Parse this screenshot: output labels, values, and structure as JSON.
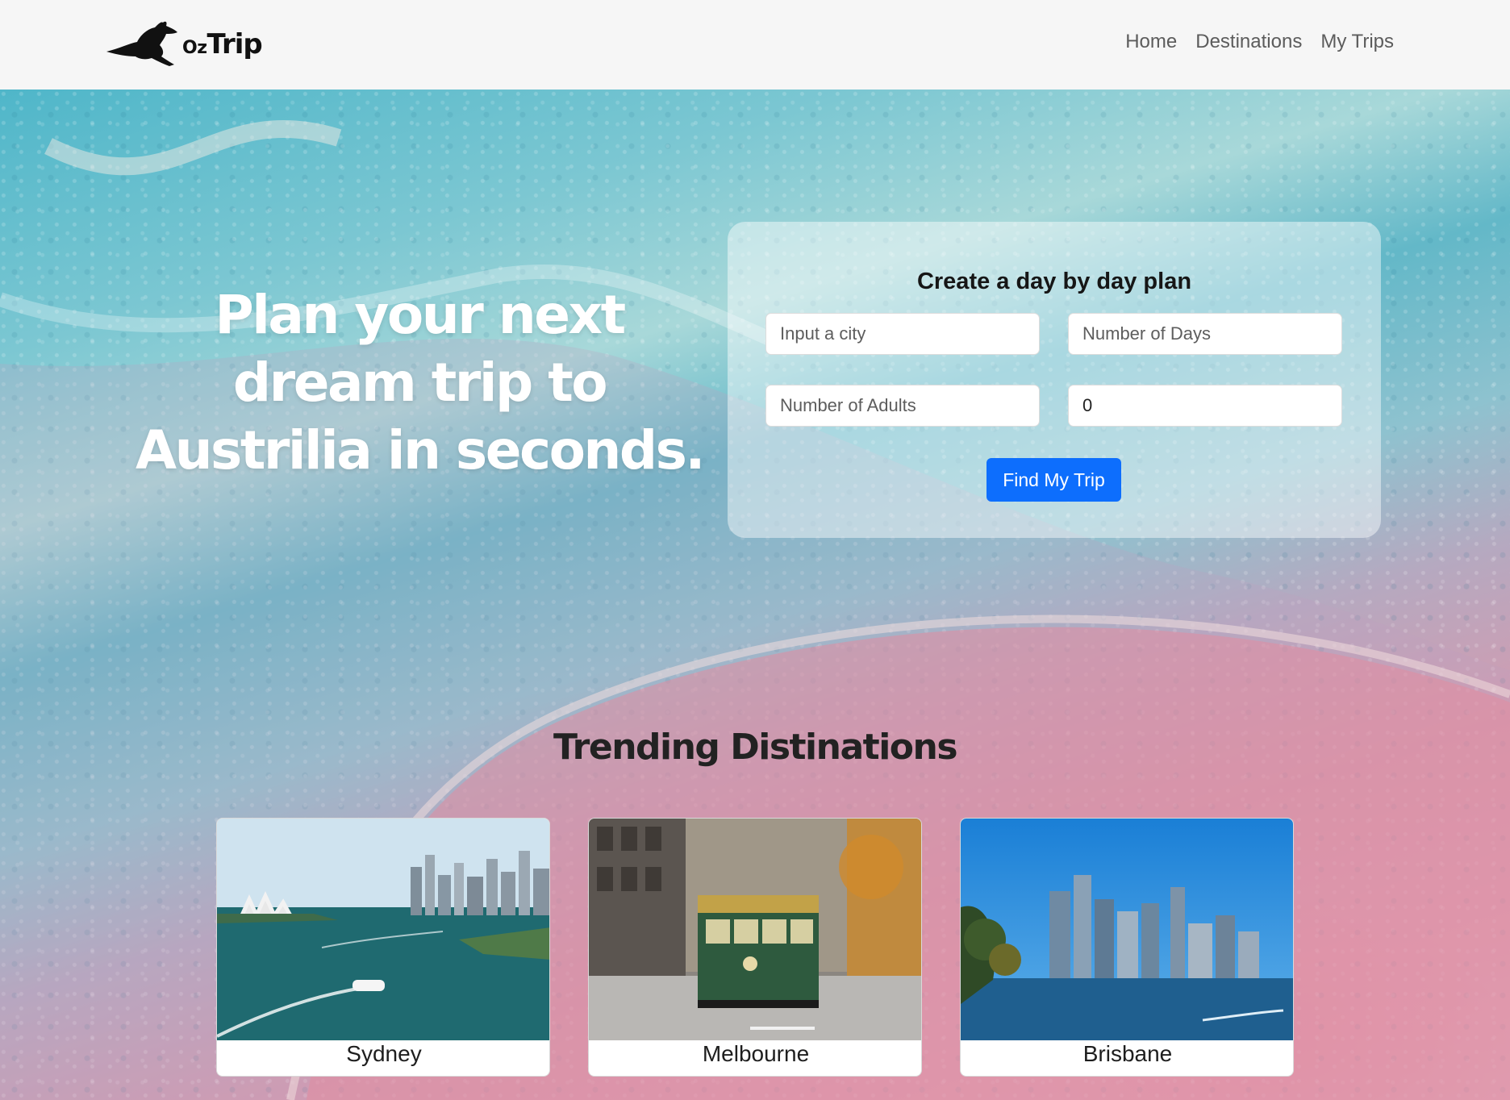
{
  "brand": {
    "prefix": "Oz",
    "name": "Trip"
  },
  "nav": {
    "items": [
      {
        "label": "Home"
      },
      {
        "label": "Destinations"
      },
      {
        "label": "My Trips"
      }
    ]
  },
  "hero": {
    "headline": "Plan your next dream trip to Austrilia in seconds."
  },
  "plan_form": {
    "title": "Create a day by day plan",
    "city_placeholder": "Input a city",
    "days_placeholder": "Number of Days",
    "adults_placeholder": "Number of Adults",
    "fourth_value": "0",
    "submit_label": "Find My Trip"
  },
  "trending": {
    "title": "Trending Distinations",
    "destinations": [
      {
        "name": "Sydney"
      },
      {
        "name": "Melbourne"
      },
      {
        "name": "Brisbane"
      }
    ]
  },
  "colors": {
    "accent": "#0d6efd",
    "nav_bg": "#f6f6f6",
    "ocean": "#4fb6c9",
    "sand": "#e3a1b3"
  }
}
